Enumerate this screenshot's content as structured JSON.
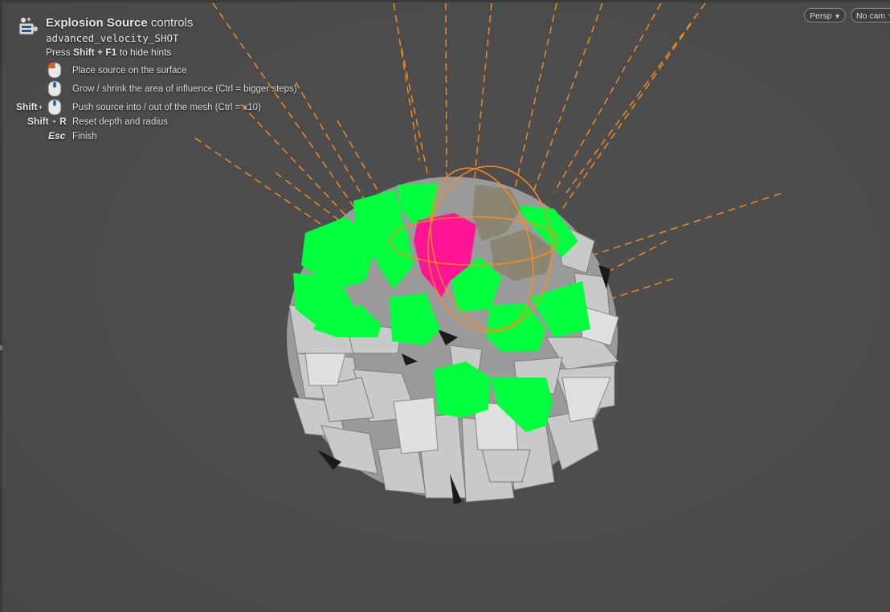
{
  "hud": {
    "title_bold": "Explosion Source",
    "title_rest": " controls",
    "node_name": "advanced_velocity_SHOT",
    "press_prefix": "Press ",
    "press_keys": "Shift + F1",
    "press_suffix": " to hide hints",
    "hints": [
      {
        "keys_mod": "",
        "keys_main": "",
        "mouse": "left-mouse-icon",
        "text": "Place source on the surface"
      },
      {
        "keys_mod": "",
        "keys_main": "",
        "mouse": "wheel-mouse-icon",
        "text": "Grow / shrink the area of influence (Ctrl = bigger steps)"
      },
      {
        "keys_mod": "Shift",
        "keys_main": "",
        "mouse": "wheel-mouse-icon",
        "text": "Push source into / out of the mesh (Ctrl = x10)"
      },
      {
        "keys_mod": "Shift",
        "keys_main": "R",
        "mouse": "",
        "text": "Reset depth and radius"
      },
      {
        "keys_mod": "",
        "keys_main": "Esc",
        "mouse": "",
        "text": "Finish"
      }
    ]
  },
  "viewport_menu": {
    "persp_label": "Persp",
    "camera_label": "No cam"
  },
  "colors": {
    "background": "#4b4b4b",
    "selected_green": "#00ff3c",
    "source_pink": "#ff1493",
    "guide_orange": "#ff8c1a",
    "fragment_gray": "#c8c8c8"
  }
}
